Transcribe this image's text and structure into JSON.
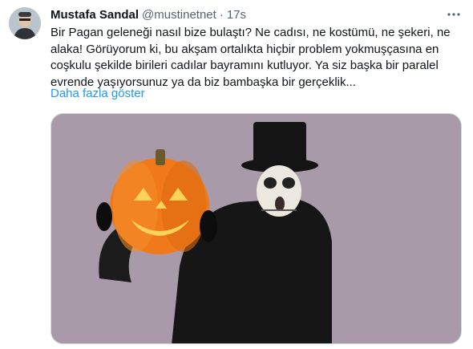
{
  "tweet": {
    "author_name": "Mustafa Sandal",
    "handle": "@mustinetnet",
    "separator": "·",
    "time": "17s",
    "more_icon": "more-horizontal-icon",
    "text": "Bir Pagan geleneği nasıl bize bulaştı? Ne cadısı, ne kostümü, ne şekeri, ne\nalaka! Görüyorum ki, bu akşam ortalıkta hiçbir problem yokmuşçasına en\ncoşkulu şekilde birileri cadılar bayramını kutluyor. Ya siz başka bir paralel\nevrende yaşıyorsunuz ya da biz bambaşka bir gerçeklik...",
    "show_more": "Daha fazla göster"
  },
  "colors": {
    "text": "#0f1419",
    "secondary": "#536471",
    "link": "#1d9bf0",
    "media_background": "#a99aa9",
    "pumpkin": "#f07a1a"
  }
}
